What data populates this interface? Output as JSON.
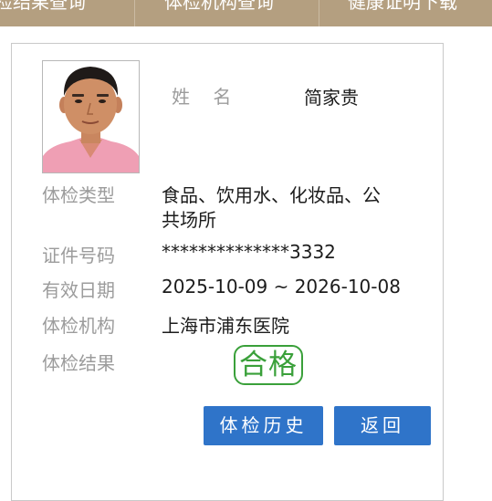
{
  "nav": {
    "tabs": [
      {
        "label": "检结果查询"
      },
      {
        "label": "体检机构查询"
      },
      {
        "label": "健康证明下载"
      }
    ]
  },
  "record": {
    "name_label": "姓    名",
    "name_value": "简家贵",
    "type_label": "体检类型",
    "type_value_line1": "食品、饮用水、化妆品、公",
    "type_value_line2": "共场所",
    "id_label": "证件号码",
    "id_value": "**************3332",
    "valid_label": "有效日期",
    "valid_value": "2025-10-09 ~ 2026-10-08",
    "org_label": "体检机构",
    "org_value": "上海市浦东医院",
    "result_label": "体检结果",
    "result_value": "合格"
  },
  "actions": {
    "history_label": "体检历史",
    "back_label": "返回"
  },
  "colors": {
    "nav_bg": "#b49f80",
    "pass_green": "#3aa03a",
    "button_blue": "#2f74c9"
  }
}
